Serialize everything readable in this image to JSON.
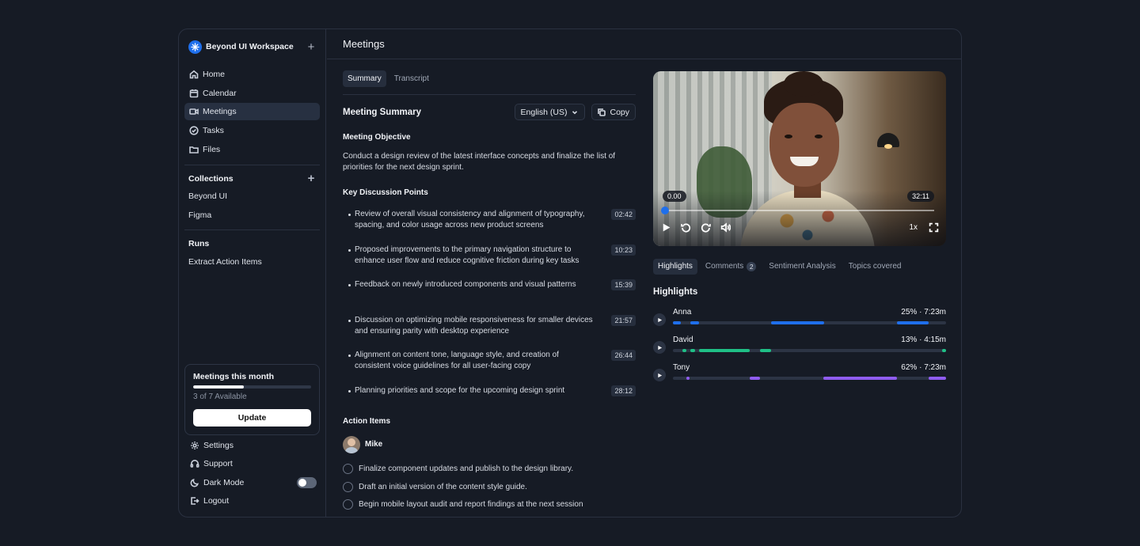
{
  "workspace": {
    "name": "Beyond UI Workspace"
  },
  "nav": [
    {
      "label": "Home",
      "icon": "home-icon"
    },
    {
      "label": "Calendar",
      "icon": "calendar-icon"
    },
    {
      "label": "Meetings",
      "icon": "video-icon",
      "active": true
    },
    {
      "label": "Tasks",
      "icon": "check-circle-icon"
    },
    {
      "label": "Files",
      "icon": "folder-icon"
    }
  ],
  "collections": {
    "title": "Collections",
    "items": [
      "Beyond UI",
      "Figma"
    ]
  },
  "runs": {
    "title": "Runs",
    "items": [
      "Extract Action Items"
    ]
  },
  "usage": {
    "title": "Meetings this month",
    "used": 3,
    "total": 7,
    "available_text": "3 of 7 Available",
    "button": "Update"
  },
  "bottom_nav": [
    {
      "label": "Settings",
      "icon": "gear-icon"
    },
    {
      "label": "Support",
      "icon": "headphones-icon"
    },
    {
      "label": "Dark Mode",
      "icon": "moon-icon",
      "toggle": true
    },
    {
      "label": "Logout",
      "icon": "logout-icon"
    }
  ],
  "page": {
    "title": "Meetings"
  },
  "tabs": [
    "Summary",
    "Transcript"
  ],
  "summary": {
    "heading": "Meeting Summary",
    "language": "English (US)",
    "copy_label": "Copy",
    "objective_title": "Meeting Objective",
    "objective": "Conduct a design review of the latest interface concepts and finalize the list of priorities for the next design sprint.",
    "discussion_title": "Key Discussion Points",
    "points": [
      {
        "text": "Review of overall visual consistency and alignment of typography, spacing, and color usage across new product screens",
        "time": "02:42"
      },
      {
        "text": "Proposed improvements to the primary navigation structure to enhance user flow and reduce cognitive friction during key tasks",
        "time": "10:23"
      },
      {
        "text": "Feedback on newly introduced components and visual patterns",
        "time": "15:39"
      },
      {
        "text": "Discussion on optimizing mobile responsiveness for smaller devices and ensuring parity with desktop experience",
        "time": "21:57"
      },
      {
        "text": "Alignment on content tone, language style, and creation of consistent voice guidelines for all user-facing copy",
        "time": "26:44"
      },
      {
        "text": "Planning priorities and scope for the upcoming design sprint",
        "time": "28:12"
      }
    ],
    "actions_title": "Action Items",
    "assignee": "Mike",
    "actions": [
      "Finalize component updates and publish to the design library.",
      "Draft an initial version of the content style guide.",
      "Begin mobile layout audit and report findings at the next session"
    ]
  },
  "video": {
    "current": "0.00",
    "duration": "32:11",
    "speed": "1x",
    "progress": 0.0
  },
  "right_tabs": [
    {
      "label": "Highlights"
    },
    {
      "label": "Comments",
      "count": "2"
    },
    {
      "label": "Sentiment Analysis"
    },
    {
      "label": "Topics covered"
    }
  ],
  "highlights": {
    "title": "Highlights",
    "people": [
      {
        "name": "Anna",
        "stat": "25% · 7:23m",
        "color": "#1f6feb",
        "segments": [
          [
            0.0,
            0.03
          ],
          [
            0.065,
            0.095
          ],
          [
            0.36,
            0.555
          ],
          [
            0.82,
            0.935
          ]
        ]
      },
      {
        "name": "David",
        "stat": "13% · 4:15m",
        "color": "#1fbf86",
        "segments": [
          [
            0.035,
            0.05
          ],
          [
            0.065,
            0.08
          ],
          [
            0.095,
            0.28
          ],
          [
            0.32,
            0.36
          ],
          [
            0.985,
            1.0
          ]
        ]
      },
      {
        "name": "Tony",
        "stat": "62% · 7:23m",
        "color": "#8f5cf0",
        "segments": [
          [
            0.05,
            0.06
          ],
          [
            0.28,
            0.32
          ],
          [
            0.55,
            0.82
          ],
          [
            0.935,
            1.0
          ]
        ]
      }
    ]
  }
}
